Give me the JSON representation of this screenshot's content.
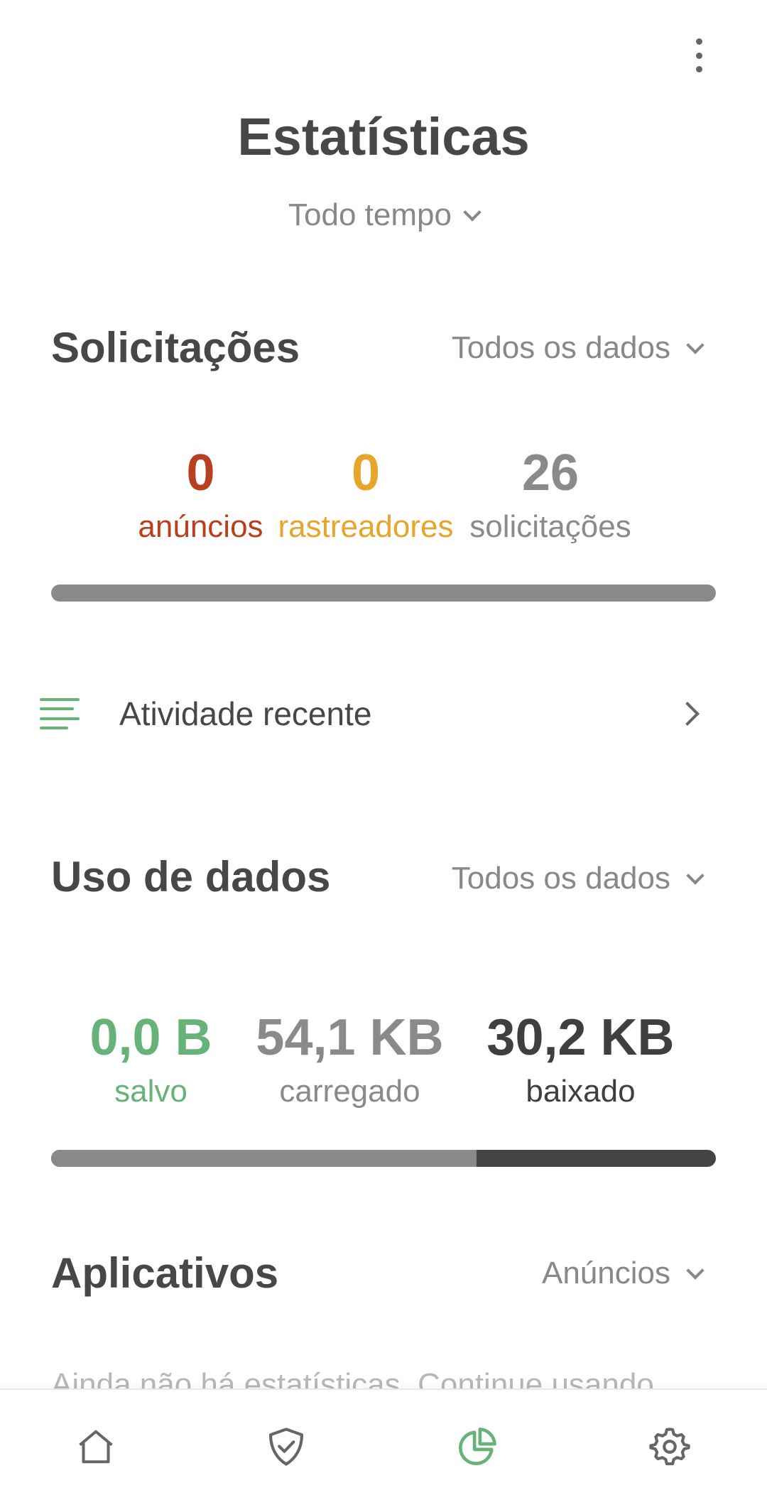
{
  "header": {
    "title": "Estatísticas",
    "period": "Todo tempo",
    "more_icon": "more-vert-icon"
  },
  "requests": {
    "title": "Solicitações",
    "filter": "Todos os dados",
    "stats": [
      {
        "value": "0",
        "label": "anúncios",
        "color": "#b8401f"
      },
      {
        "value": "0",
        "label": "rastreadores",
        "color": "#e6a52b"
      },
      {
        "value": "26",
        "label": "solicitações",
        "color": "#8a8a8a"
      }
    ],
    "bar": {
      "blocked_fraction": 0
    }
  },
  "recent_activity": {
    "label": "Atividade recente",
    "icon": "list-icon"
  },
  "data_usage": {
    "title": "Uso de dados",
    "filter": "Todos os dados",
    "stats": [
      {
        "value": "0,0 B",
        "label": "salvo",
        "color": "#67b279"
      },
      {
        "value": "54,1 KB",
        "label": "carregado",
        "color": "#8a8a8a"
      },
      {
        "value": "30,2 KB",
        "label": "baixado",
        "color": "#3f3f3f"
      }
    ],
    "bar": {
      "uploaded_fraction": 0.64
    }
  },
  "apps": {
    "title": "Aplicativos",
    "filter": "Anúncios",
    "peek_text": "Ainda não há estatísticas. Continue usando"
  },
  "bottom_nav": [
    {
      "name": "home",
      "icon": "home-icon",
      "active": false
    },
    {
      "name": "protection",
      "icon": "shield-check-icon",
      "active": false
    },
    {
      "name": "statistics",
      "icon": "pie-chart-icon",
      "active": true
    },
    {
      "name": "settings",
      "icon": "gear-icon",
      "active": false
    }
  ],
  "colors": {
    "accent": "#67b279",
    "ads": "#b8401f",
    "trackers": "#e6a52b",
    "neutral": "#8a8a8a",
    "dark": "#444444"
  }
}
